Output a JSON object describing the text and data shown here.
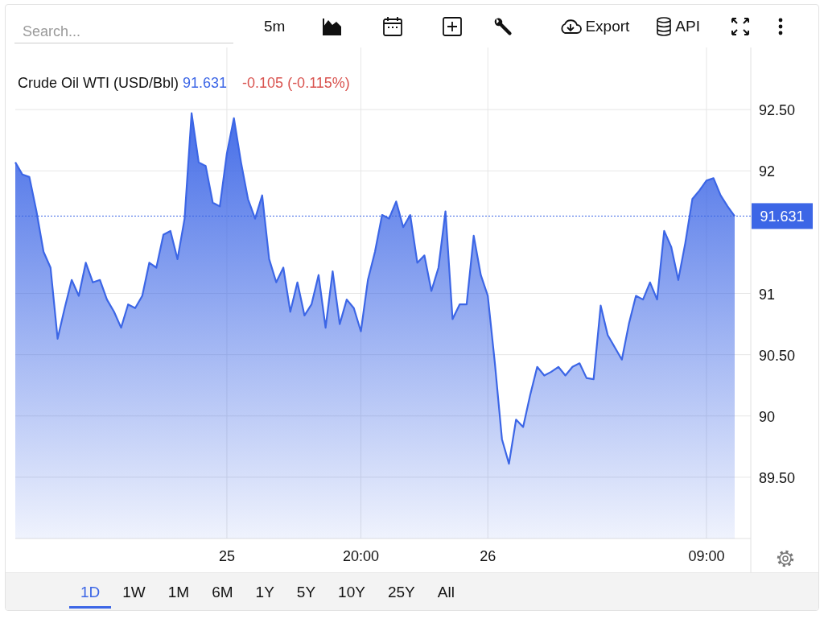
{
  "toolbar": {
    "search": {
      "placeholder": "Search..."
    },
    "interval": "5m",
    "export": "Export",
    "api": "API"
  },
  "legend": {
    "name": "Crude Oil WTI (USD/Bbl)",
    "price": "91.631",
    "change": "-0.105 (-0.115%)"
  },
  "chart_data": {
    "type": "area",
    "ylim": [
      89,
      93
    ],
    "ref_lines": [
      {
        "axis": "y",
        "value": 91.631,
        "label": "91.631"
      }
    ],
    "grid": true,
    "yticks": [
      {
        "value": 89.5,
        "label": "89.50"
      },
      {
        "value": 90,
        "label": "90"
      },
      {
        "value": 90.5,
        "label": "90.50"
      },
      {
        "value": 91,
        "label": "91"
      },
      {
        "value": 92,
        "label": "92"
      },
      {
        "value": 92.5,
        "label": "92.50"
      }
    ],
    "categories": [
      null,
      null,
      null,
      null,
      null,
      null,
      null,
      null,
      null,
      null,
      null,
      null,
      null,
      null,
      null,
      null,
      null,
      null,
      null,
      null,
      null,
      null,
      null,
      null,
      null,
      null,
      null,
      null,
      null,
      null,
      "25",
      null,
      null,
      null,
      null,
      null,
      null,
      null,
      null,
      null,
      null,
      null,
      null,
      null,
      null,
      null,
      null,
      null,
      null,
      "20:00",
      null,
      null,
      null,
      null,
      null,
      null,
      null,
      null,
      null,
      null,
      null,
      null,
      null,
      null,
      null,
      null,
      null,
      "26",
      null,
      null,
      null,
      null,
      null,
      null,
      null,
      null,
      null,
      null,
      null,
      null,
      null,
      null,
      null,
      null,
      null,
      null,
      null,
      null,
      null,
      null,
      null,
      null,
      null,
      null,
      null,
      null,
      null,
      null,
      "09:00",
      null,
      null,
      null,
      null
    ],
    "series": [
      {
        "color": "#3c66e6",
        "values": [
          92.07,
          91.97,
          91.95,
          91.67,
          91.34,
          91.21,
          90.63,
          90.88,
          91.11,
          90.98,
          91.25,
          91.09,
          91.11,
          90.95,
          90.85,
          90.72,
          90.91,
          90.88,
          90.98,
          91.25,
          91.21,
          91.48,
          91.51,
          91.28,
          91.61,
          92.47,
          92.07,
          92.04,
          91.74,
          91.71,
          92.14,
          92.43,
          92.07,
          91.77,
          91.61,
          91.8,
          91.28,
          91.09,
          91.21,
          90.85,
          91.09,
          90.82,
          90.91,
          91.15,
          90.72,
          91.18,
          90.75,
          90.95,
          90.88,
          90.69,
          91.11,
          91.34,
          91.64,
          91.61,
          91.75,
          91.54,
          91.64,
          91.25,
          91.31,
          91.02,
          91.21,
          91.67,
          90.79,
          90.91,
          90.91,
          91.47,
          91.15,
          90.98,
          90.43,
          89.81,
          89.61,
          89.97,
          89.91,
          90.17,
          90.4,
          90.33,
          90.36,
          90.4,
          90.33,
          90.4,
          90.43,
          90.31,
          90.3,
          90.9,
          90.66,
          90.56,
          90.46,
          90.75,
          90.98,
          90.95,
          91.09,
          90.95,
          91.51,
          91.38,
          91.11,
          91.41,
          91.77,
          91.84,
          91.92,
          91.94,
          91.8,
          91.71,
          91.63
        ]
      }
    ]
  },
  "ranges": [
    {
      "label": "1D",
      "selected": true
    },
    {
      "label": "1W",
      "selected": false
    },
    {
      "label": "1M",
      "selected": false
    },
    {
      "label": "6M",
      "selected": false
    },
    {
      "label": "1Y",
      "selected": false
    },
    {
      "label": "5Y",
      "selected": false
    },
    {
      "label": "10Y",
      "selected": false
    },
    {
      "label": "25Y",
      "selected": false
    },
    {
      "label": "All",
      "selected": false
    }
  ]
}
